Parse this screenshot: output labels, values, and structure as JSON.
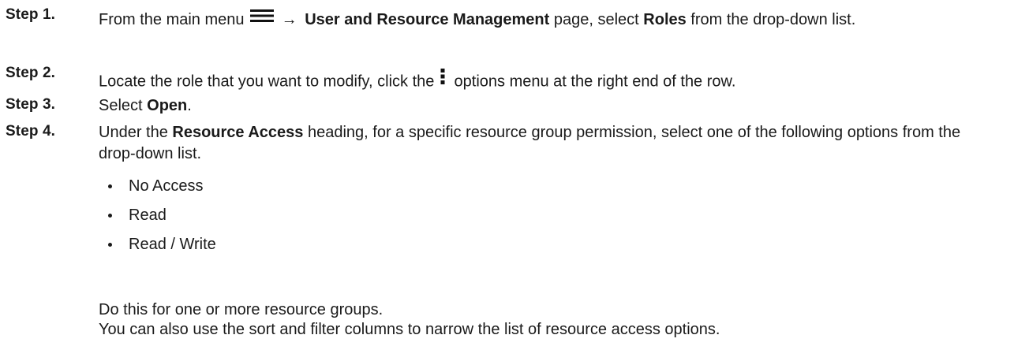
{
  "steps": [
    {
      "label": "Step 1.",
      "seg1": "From the main menu ",
      "icon": "hamburger-menu-icon",
      "arrow": "→",
      "bold1": "User and Resource Management",
      "seg2": " page, select ",
      "bold2": "Roles",
      "seg3": " from the drop-down list."
    },
    {
      "label": "Step 2.",
      "seg1": "Locate the role that you want to modify, click the ",
      "icon": "more-vertical-icon",
      "seg2": " options menu at the right end of the row."
    },
    {
      "label": "Step 3.",
      "seg1": "Select ",
      "bold1": "Open",
      "seg2": "."
    },
    {
      "label": "Step 4.",
      "seg1": "Under the ",
      "bold1": "Resource Access",
      "seg2": " heading, for a specific resource group permission, select one of the following options from the drop-down list.",
      "options": [
        "No Access",
        "Read",
        "Read / Write"
      ],
      "note1": "Do this for one or more resource groups.",
      "note2": "You can also use the sort and filter columns to narrow the list of resource access options."
    }
  ]
}
